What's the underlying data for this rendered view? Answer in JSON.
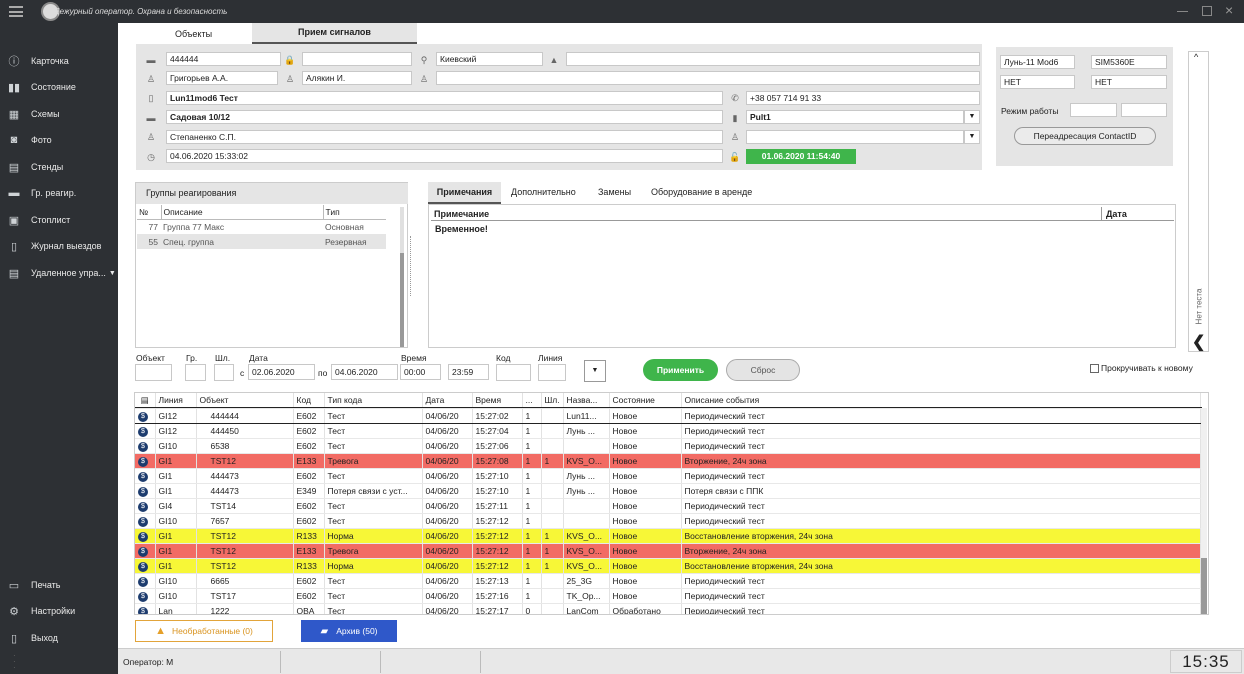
{
  "titlebar": {
    "title": "Дежурный оператор. Охрана и безопасность"
  },
  "sidebar": {
    "items": [
      "Карточка",
      "Состояние",
      "Схемы",
      "Фото",
      "Стенды",
      "Гр. реагир.",
      "Стоплист",
      "Журнал выездов",
      "Удаленное упра..."
    ],
    "bottom": [
      "Печать",
      "Настройки",
      "Выход"
    ]
  },
  "tabs": {
    "objects": "Объекты",
    "signals": "Прием сигналов"
  },
  "card": {
    "number": "444444",
    "region": "Киевский",
    "person1": "Григорьев А.А.",
    "person2": "Алякин И.",
    "name": "Lun11mod6 Тест",
    "phone": "+38 057 714 91 33",
    "address": "Садовая 10/12",
    "pult": "Pult1",
    "contact": "Степаненко С.П.",
    "datetime": "04.06.2020 15:33:02",
    "date_green": "01.06.2020 11:54:40"
  },
  "device": {
    "model": "Лунь-11 Mod6",
    "sim": "SIM5360E",
    "val1": "НЕТ",
    "val2": "НЕТ",
    "mode_label": "Режим работы",
    "redirect_btn": "Переадресация ContactID"
  },
  "groups": {
    "title": "Группы реагирования",
    "headers": [
      "№",
      "Описание",
      "Тип"
    ],
    "rows": [
      [
        "77",
        "Группа 77 Макс",
        "Основная"
      ],
      [
        "55",
        "Спец. группа",
        "Резервная"
      ]
    ]
  },
  "notes": {
    "tabs": [
      "Примечания",
      "Дополнительно",
      "Замены",
      "Оборудование в аренде"
    ],
    "headers": [
      "Примечание",
      "Дата"
    ],
    "rows": [
      [
        "Временное!",
        ""
      ]
    ]
  },
  "side_tab": "Нет теста",
  "filter": {
    "labels": {
      "object": "Объект",
      "group": "Гр.",
      "loop": "Шл.",
      "date": "Дата",
      "from": "с",
      "to": "по",
      "time": "Время",
      "code": "Код",
      "line": "Линия"
    },
    "date_from": "02.06.2020",
    "date_to": "04.06.2020",
    "time_from": "00:00",
    "time_to": "23:59",
    "apply": "Применить",
    "reset": "Сброс",
    "autoscroll": "Прокручивать к новому"
  },
  "events": {
    "headers": [
      "Линия",
      "Объект",
      "Код",
      "Тип кода",
      "Дата",
      "Время",
      "...",
      "Шл.",
      "Назва...",
      "Состояние",
      "Описание события"
    ],
    "rows": [
      [
        "GI12",
        "444444",
        "E602",
        "Тест",
        "04/06/20",
        "15:27:02",
        "1",
        "",
        "Lun11...",
        "Новое",
        "Периодический тест",
        "sel"
      ],
      [
        "GI12",
        "444450",
        "E602",
        "Тест",
        "04/06/20",
        "15:27:04",
        "1",
        "",
        "Лунь ...",
        "Новое",
        "Периодический тест",
        ""
      ],
      [
        "GI10",
        "6538",
        "E602",
        "Тест",
        "04/06/20",
        "15:27:06",
        "1",
        "",
        "",
        "Новое",
        "Периодический тест",
        ""
      ],
      [
        "GI1",
        "TST12",
        "E133",
        "Тревога",
        "04/06/20",
        "15:27:08",
        "1",
        "1",
        "KVS_O...",
        "Новое",
        "Вторжение, 24ч зона",
        "red"
      ],
      [
        "GI1",
        "444473",
        "E602",
        "Тест",
        "04/06/20",
        "15:27:10",
        "1",
        "",
        "Лунь ...",
        "Новое",
        "Периодический тест",
        ""
      ],
      [
        "GI1",
        "444473",
        "E349",
        "Потеря связи с уст...",
        "04/06/20",
        "15:27:10",
        "1",
        "",
        "Лунь ...",
        "Новое",
        "Потеря связи с ППК",
        ""
      ],
      [
        "GI4",
        "TST14",
        "E602",
        "Тест",
        "04/06/20",
        "15:27:11",
        "1",
        "",
        "",
        "Новое",
        "Периодический тест",
        ""
      ],
      [
        "GI10",
        "7657",
        "E602",
        "Тест",
        "04/06/20",
        "15:27:12",
        "1",
        "",
        "",
        "Новое",
        "Периодический тест",
        ""
      ],
      [
        "GI1",
        "TST12",
        "R133",
        "Норма",
        "04/06/20",
        "15:27:12",
        "1",
        "1",
        "KVS_O...",
        "Новое",
        "Восстановление вторжения, 24ч зона",
        "yellow"
      ],
      [
        "GI1",
        "TST12",
        "E133",
        "Тревога",
        "04/06/20",
        "15:27:12",
        "1",
        "1",
        "KVS_O...",
        "Новое",
        "Вторжение, 24ч зона",
        "red"
      ],
      [
        "GI1",
        "TST12",
        "R133",
        "Норма",
        "04/06/20",
        "15:27:12",
        "1",
        "1",
        "KVS_O...",
        "Новое",
        "Восстановление вторжения, 24ч зона",
        "yellow"
      ],
      [
        "GI10",
        "6665",
        "E602",
        "Тест",
        "04/06/20",
        "15:27:13",
        "1",
        "",
        "25_3G",
        "Новое",
        "Периодический тест",
        ""
      ],
      [
        "GI10",
        "TST17",
        "E602",
        "Тест",
        "04/06/20",
        "15:27:16",
        "1",
        "",
        "TK_Op...",
        "Новое",
        "Периодический тест",
        ""
      ],
      [
        "Lan",
        "1222",
        "OBA",
        "Тест",
        "04/06/20",
        "15:27:17",
        "0",
        "",
        "LanCom",
        "Обработано",
        "Периодический тест",
        ""
      ]
    ]
  },
  "bottom": {
    "unprocessed": "Необработанные (0)",
    "archive": "Архив (50)"
  },
  "status": {
    "operator": "Оператор: М",
    "clock": "15:35"
  },
  "colors": {
    "red": "#f26b64",
    "yellow": "#f7f737",
    "green": "#3fb54b",
    "archive": "#2f58c9",
    "sidebar": "#2d3034"
  }
}
